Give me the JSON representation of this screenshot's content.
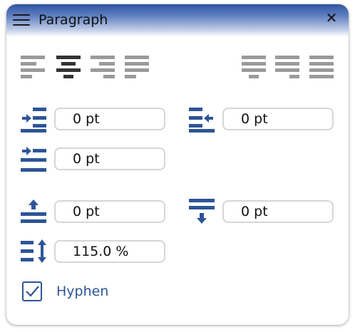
{
  "panel": {
    "title": "Paragraph",
    "menu_icon": "hamburger-menu-icon",
    "close_icon": "close-x-icon",
    "close_glyph": "✕"
  },
  "alignment": {
    "buttons": [
      {
        "name": "align-left",
        "icon": "align-left-icon",
        "selected": false
      },
      {
        "name": "align-center",
        "icon": "align-center-icon",
        "selected": true
      },
      {
        "name": "align-right",
        "icon": "align-right-icon",
        "selected": false
      },
      {
        "name": "justify",
        "icon": "justify-icon",
        "selected": false
      },
      {
        "name": "justify-last-left",
        "icon": "justify-last-left-icon",
        "selected": false
      },
      {
        "name": "justify-last-right",
        "icon": "justify-last-right-icon",
        "selected": false
      },
      {
        "name": "justify-all",
        "icon": "justify-all-icon",
        "selected": false
      }
    ]
  },
  "indents": {
    "left_indent": {
      "value": "0 pt",
      "icon": "indent-left-icon"
    },
    "right_indent": {
      "value": "0 pt",
      "icon": "indent-right-icon"
    },
    "first_line_indent": {
      "value": "0 pt",
      "icon": "first-line-indent-icon"
    }
  },
  "spacing": {
    "space_before": {
      "value": "0 pt",
      "icon": "space-before-icon"
    },
    "space_after": {
      "value": "0 pt",
      "icon": "space-after-icon"
    },
    "line_spacing": {
      "value": "115.0 %",
      "icon": "line-spacing-icon"
    }
  },
  "hyphen": {
    "label": "Hyphen",
    "checked": true
  },
  "colors": {
    "accent": "#2d5597",
    "selected_icon": "#333333",
    "unselected_icon": "#9a9a9a",
    "header_top": "#2f55a4"
  }
}
